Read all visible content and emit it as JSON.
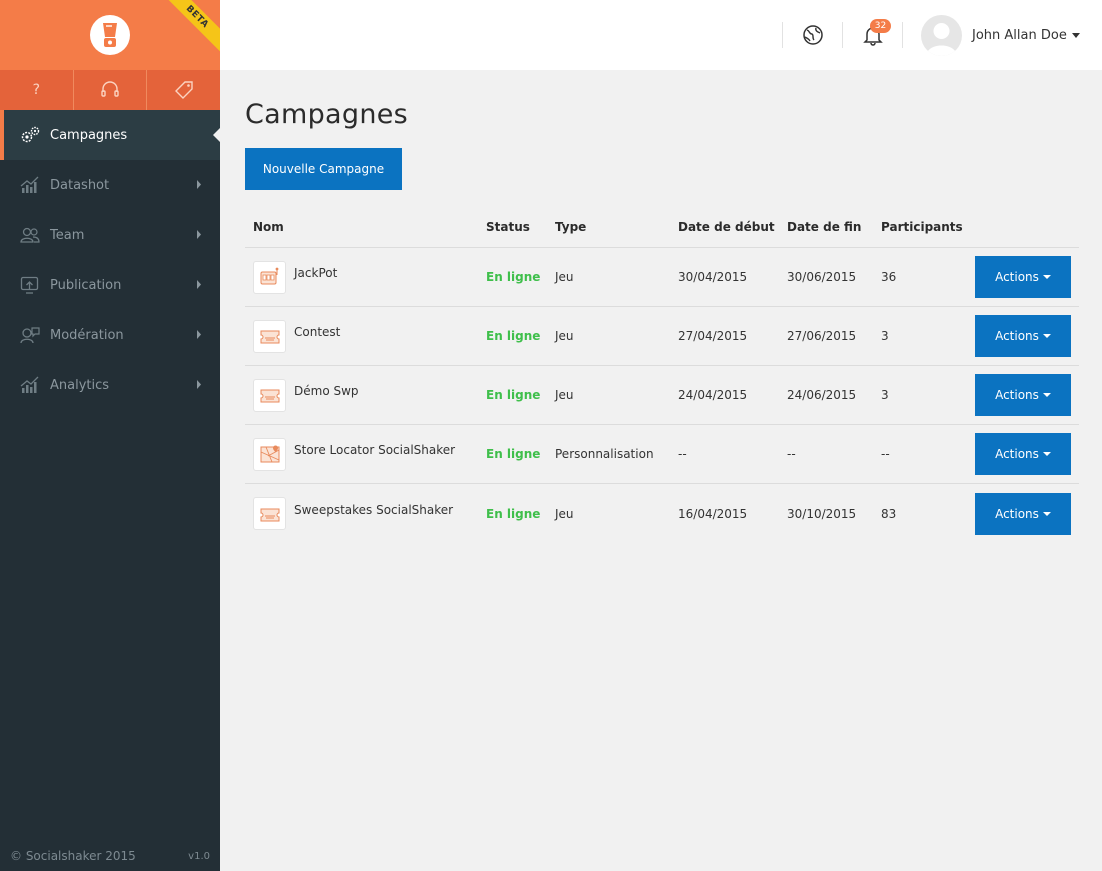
{
  "brand": {
    "beta_label": "BETA",
    "accent": "#f47c48",
    "dark": "#232f36",
    "primary": "#0b73c1"
  },
  "quick_actions": [
    {
      "icon": "question-icon"
    },
    {
      "icon": "headset-icon"
    },
    {
      "icon": "tag-icon"
    }
  ],
  "nav": [
    {
      "label": "Campagnes",
      "icon": "gears-icon",
      "active": true
    },
    {
      "label": "Datashot",
      "icon": "chart-icon"
    },
    {
      "label": "Team",
      "icon": "users-icon"
    },
    {
      "label": "Publication",
      "icon": "publish-icon"
    },
    {
      "label": "Modération",
      "icon": "moderation-icon"
    },
    {
      "label": "Analytics",
      "icon": "analytics-icon"
    }
  ],
  "footer": {
    "copyright": "© Socialshaker 2015",
    "version": "v1.0"
  },
  "header": {
    "notifications_count": "32",
    "user_name": "John Allan Doe"
  },
  "page": {
    "title": "Campagnes",
    "new_button": "Nouvelle Campagne"
  },
  "table": {
    "columns": {
      "nom": "Nom",
      "status": "Status",
      "type": "Type",
      "debut": "Date de début",
      "fin": "Date de fin",
      "participants": "Participants"
    },
    "action_label": "Actions",
    "rows": [
      {
        "name": "JackPot",
        "status": "En ligne",
        "type": "Jeu",
        "debut": "30/04/2015",
        "fin": "30/06/2015",
        "participants": "36",
        "icon": "slot-machine-icon"
      },
      {
        "name": "Contest",
        "status": "En ligne",
        "type": "Jeu",
        "debut": "27/04/2015",
        "fin": "27/06/2015",
        "participants": "3",
        "icon": "ticket-icon"
      },
      {
        "name": "Démo Swp",
        "status": "En ligne",
        "type": "Jeu",
        "debut": "24/04/2015",
        "fin": "24/06/2015",
        "participants": "3",
        "icon": "ticket-icon"
      },
      {
        "name": "Store Locator SocialShaker",
        "status": "En ligne",
        "type": "Personnalisation",
        "debut": "--",
        "fin": "--",
        "participants": "--",
        "icon": "map-icon"
      },
      {
        "name": "Sweepstakes SocialShaker",
        "status": "En ligne",
        "type": "Jeu",
        "debut": "16/04/2015",
        "fin": "30/10/2015",
        "participants": "83",
        "icon": "ticket-icon"
      }
    ]
  }
}
